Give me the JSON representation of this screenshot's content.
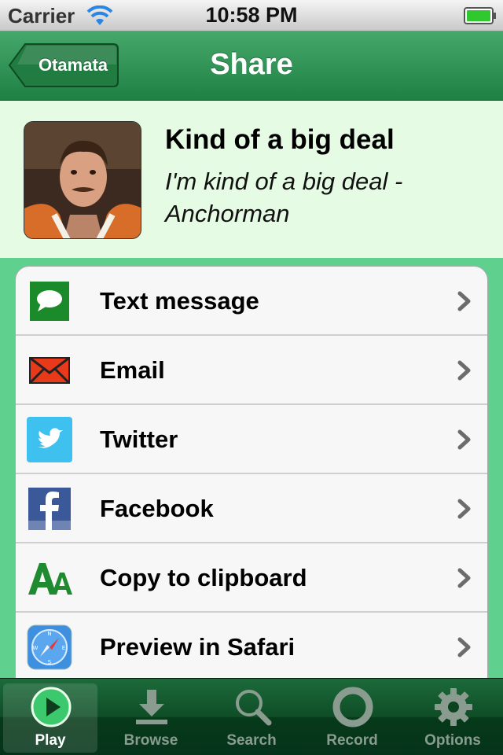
{
  "status_bar": {
    "carrier": "Carrier",
    "time": "10:58 PM"
  },
  "nav": {
    "back_label": "Otamata",
    "title": "Share"
  },
  "clip": {
    "title": "Kind of a big deal",
    "subtitle": "I'm kind of a big deal - Anchorman"
  },
  "share_options": [
    {
      "label": "Text message",
      "icon": "speech-bubble-icon"
    },
    {
      "label": "Email",
      "icon": "envelope-icon"
    },
    {
      "label": "Twitter",
      "icon": "twitter-bird-icon"
    },
    {
      "label": "Facebook",
      "icon": "facebook-icon"
    },
    {
      "label": "Copy to clipboard",
      "icon": "font-aa-icon"
    },
    {
      "label": "Preview in Safari",
      "icon": "safari-compass-icon"
    }
  ],
  "tabs": [
    {
      "label": "Play",
      "icon": "play-icon",
      "selected": true
    },
    {
      "label": "Browse",
      "icon": "download-arrow-icon"
    },
    {
      "label": "Search",
      "icon": "magnifier-icon"
    },
    {
      "label": "Record",
      "icon": "record-circle-icon"
    },
    {
      "label": "Options",
      "icon": "gear-icon"
    }
  ],
  "colors": {
    "accent_green": "#1f8044",
    "header_background": "#e5fbe3",
    "page_background": "#5fd08e"
  }
}
